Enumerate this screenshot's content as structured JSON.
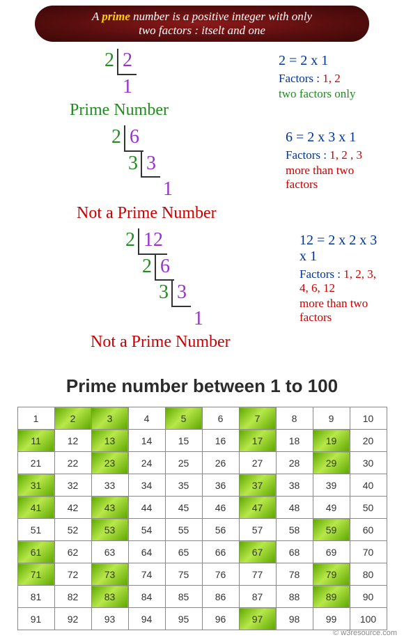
{
  "banner": {
    "line1_a": "A ",
    "line1_prime": "prime",
    "line1_b": " number is a positive integer with only",
    "line2": "two factors : itselt and one"
  },
  "ex1": {
    "d1_divisor": "2",
    "d1_q": "2",
    "d2_q": "1",
    "verdict": "Prime Number",
    "eq": "2 = 2 x 1",
    "factors_label": "Factors : ",
    "factors_vals": "1, 2",
    "note": "two factors only"
  },
  "ex2": {
    "d1_divisor": "2",
    "d1_q": "6",
    "d2_divisor": "3",
    "d2_q": "3",
    "d3_q": "1",
    "verdict": "Not a Prime Number",
    "eq": "6 = 2 x 3 x 1",
    "factors_label": "Factors :  ",
    "factors_vals": "1, 2 , 3",
    "note": "more than two factors"
  },
  "ex3": {
    "d1_divisor": "2",
    "d1_q": "12",
    "d2_divisor": "2",
    "d2_q": "6",
    "d3_divisor": "3",
    "d3_q": "3",
    "d4_q": "1",
    "verdict": "Not a Prime Number",
    "eq": "12 = 2 x 2 x 3 x 1",
    "factors_label": "Factors : ",
    "factors_vals": "1, 2, 3, 4, 6, 12",
    "note": "more than two factors"
  },
  "table_title": "Prime number between 1 to 100",
  "copyright": "© w3resource.com",
  "chart_data": {
    "type": "table",
    "title": "Prime number between 1 to 100",
    "range": [
      1,
      100
    ],
    "columns": 10,
    "highlighted_primes": [
      2,
      3,
      5,
      7,
      11,
      13,
      17,
      19,
      23,
      29,
      31,
      37,
      41,
      43,
      47,
      53,
      59,
      61,
      67,
      71,
      73,
      79,
      83,
      89,
      97
    ]
  }
}
